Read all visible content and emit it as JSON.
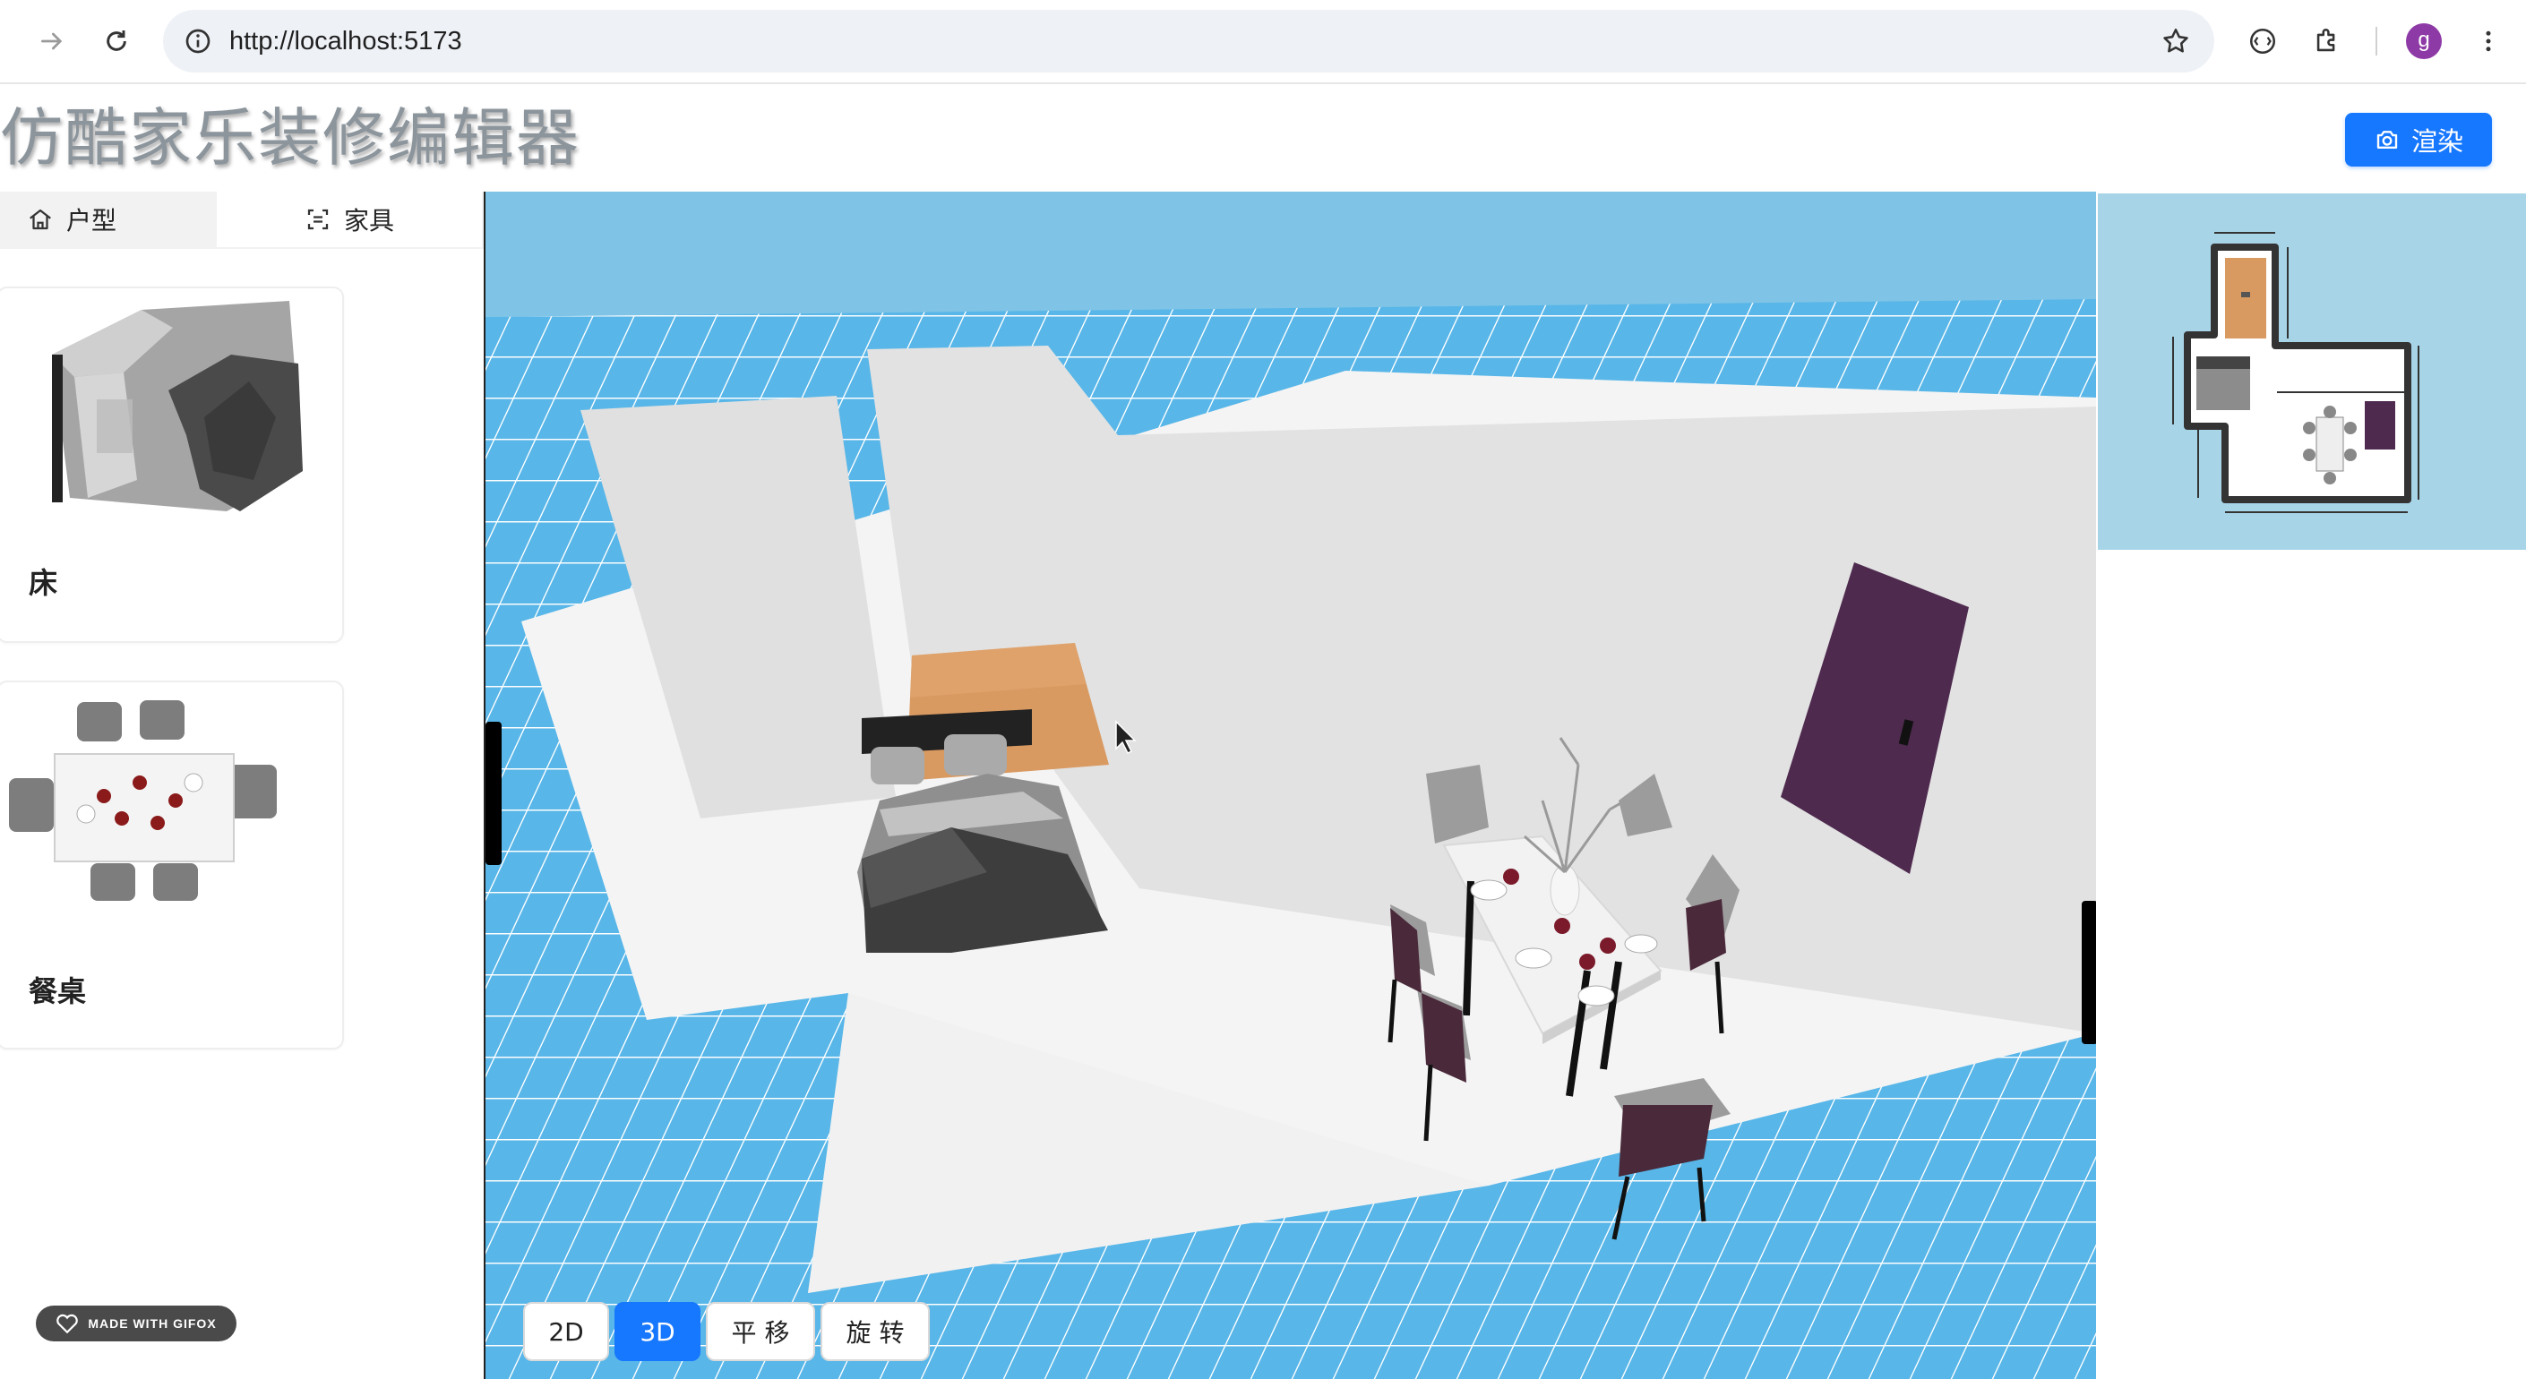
{
  "browser": {
    "url": "http://localhost:5173",
    "profile_initial": "g"
  },
  "header": {
    "title": "仿酷家乐装修编辑器",
    "render_label": "渲染"
  },
  "sidebar": {
    "tabs": [
      {
        "label": "户型",
        "icon": "home-icon",
        "active": false
      },
      {
        "label": "家具",
        "icon": "scan-icon",
        "active": true
      }
    ],
    "items": [
      {
        "label": "床"
      },
      {
        "label": "餐桌"
      }
    ]
  },
  "viewport": {
    "modes": [
      {
        "label": "2D",
        "active": false
      },
      {
        "label": "3D",
        "active": true
      },
      {
        "label": "平 移",
        "active": false
      },
      {
        "label": "旋 转",
        "active": false
      }
    ]
  },
  "watermark": "MADE WITH GIFOX",
  "colors": {
    "primary": "#1677ff",
    "sky": "#7fc4e6",
    "door": "#4e2a4e",
    "floor_wood": "#d99a62"
  }
}
